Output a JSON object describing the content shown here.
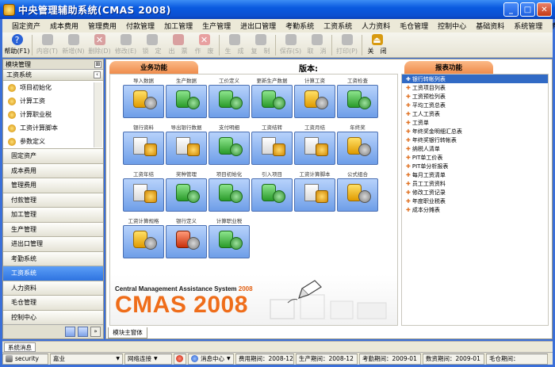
{
  "window": {
    "title": "中央管理辅助系统(CMAS 2008)",
    "min_icon": "minimize-icon",
    "max_icon": "maximize-icon",
    "close_icon": "close-icon"
  },
  "menu": [
    "固定资产",
    "成本费用",
    "管理费用",
    "付款管理",
    "加工管理",
    "生产管理",
    "进出口管理",
    "考勤系统",
    "工资系统",
    "人力资料",
    "毛仓管理",
    "控制中心",
    "基础资料",
    "系统管理",
    "帮助"
  ],
  "toolbar": [
    {
      "label": "帮助(F1)",
      "icon": "help-icon",
      "enabled": true
    },
    {
      "label": "内容(T)",
      "icon": "content-icon",
      "enabled": false
    },
    {
      "label": "新增(N)",
      "icon": "new-icon",
      "enabled": false
    },
    {
      "label": "删除(D)",
      "icon": "delete-icon",
      "enabled": false
    },
    {
      "label": "修改(E)",
      "icon": "edit-icon",
      "enabled": false
    },
    {
      "label": "锁　定",
      "icon": "lock-icon",
      "enabled": false
    },
    {
      "label": "出　票",
      "icon": "ticket-icon",
      "enabled": false
    },
    {
      "label": "作　废",
      "icon": "void-icon",
      "enabled": false
    },
    {
      "label": "生　成",
      "icon": "generate-icon",
      "enabled": false
    },
    {
      "label": "复　制",
      "icon": "copy-icon",
      "enabled": false
    },
    {
      "label": "保存(S)",
      "icon": "save-icon",
      "enabled": false
    },
    {
      "label": "取　消",
      "icon": "cancel-icon",
      "enabled": false
    },
    {
      "label": "打印(P)",
      "icon": "print-icon",
      "enabled": false
    },
    {
      "label": "关　闭",
      "icon": "close-icon",
      "enabled": true
    }
  ],
  "left_panel": {
    "header": "模块管理",
    "section": "工资系统",
    "sub_items": [
      "项目初始化",
      "计算工资",
      "计算职业税",
      "工资计算脚本",
      "参数定义"
    ],
    "groups": [
      "固定资产",
      "成本费用",
      "管理费用",
      "付款管理",
      "加工管理",
      "生产管理",
      "进出口管理",
      "考勤系统",
      "工资系统",
      "人力资料",
      "毛仓管理",
      "控制中心"
    ],
    "active_group": "工资系统"
  },
  "main": {
    "func_tab": "业务功能",
    "version_label": "版本:",
    "report_tab": "报表功能",
    "bottom_tab": "模块主窗体",
    "functions": [
      {
        "label": "导入数据",
        "style": "gold"
      },
      {
        "label": "生产数据",
        "style": "green"
      },
      {
        "label": "工价定义",
        "style": "green"
      },
      {
        "label": "更新生产数据",
        "style": "green"
      },
      {
        "label": "计算工资",
        "style": "gold"
      },
      {
        "label": "工资检查",
        "style": "green"
      },
      {
        "label": "银行资料",
        "style": "doc"
      },
      {
        "label": "导出银行数据",
        "style": "doc"
      },
      {
        "label": "支付明细",
        "style": "green"
      },
      {
        "label": "工资结转",
        "style": "doc"
      },
      {
        "label": "工资月结",
        "style": "doc"
      },
      {
        "label": "年终奖",
        "style": "gold"
      },
      {
        "label": "工资年结",
        "style": "doc"
      },
      {
        "label": "奖种管理",
        "style": "green"
      },
      {
        "label": "项目初始化",
        "style": "green"
      },
      {
        "label": "引入项目",
        "style": "green"
      },
      {
        "label": "工资计算脚本",
        "style": "doc"
      },
      {
        "label": "公式组合",
        "style": "gold"
      },
      {
        "label": "工资计算规格",
        "style": "gold"
      },
      {
        "label": "银行定义",
        "style": "red"
      },
      {
        "label": "计算职业税",
        "style": "green"
      }
    ],
    "logo_sub": "Central Management Assistance System",
    "logo_year": "2008",
    "logo_main": "CMAS 2008",
    "reports": [
      "银行转帐列表",
      "工资项目列表",
      "工资预检列表",
      "平均工资总表",
      "工人工资表",
      "工资单",
      "年终奖金明细汇总表",
      "年终奖银行转帐表",
      "纳税人清单",
      "PIT单工价表",
      "PIT单分析报表",
      "每月工资清单",
      "员工工资资料",
      "修改工资记录",
      "年度职业税表",
      "成本分摊表"
    ],
    "selected_report": 0
  },
  "sysmsg_tab": "系统消息",
  "status": {
    "user": "security",
    "company": "嘉业",
    "network": "网络连接",
    "message_center": "消息中心",
    "cost_period": "费用期间：2008-12",
    "production_period": "生产期间：2008-12",
    "attendance_period": "考勤期间：2009-01",
    "salary_period": "数资期间：2009-01",
    "warehouse_period": "毛仓期间："
  }
}
